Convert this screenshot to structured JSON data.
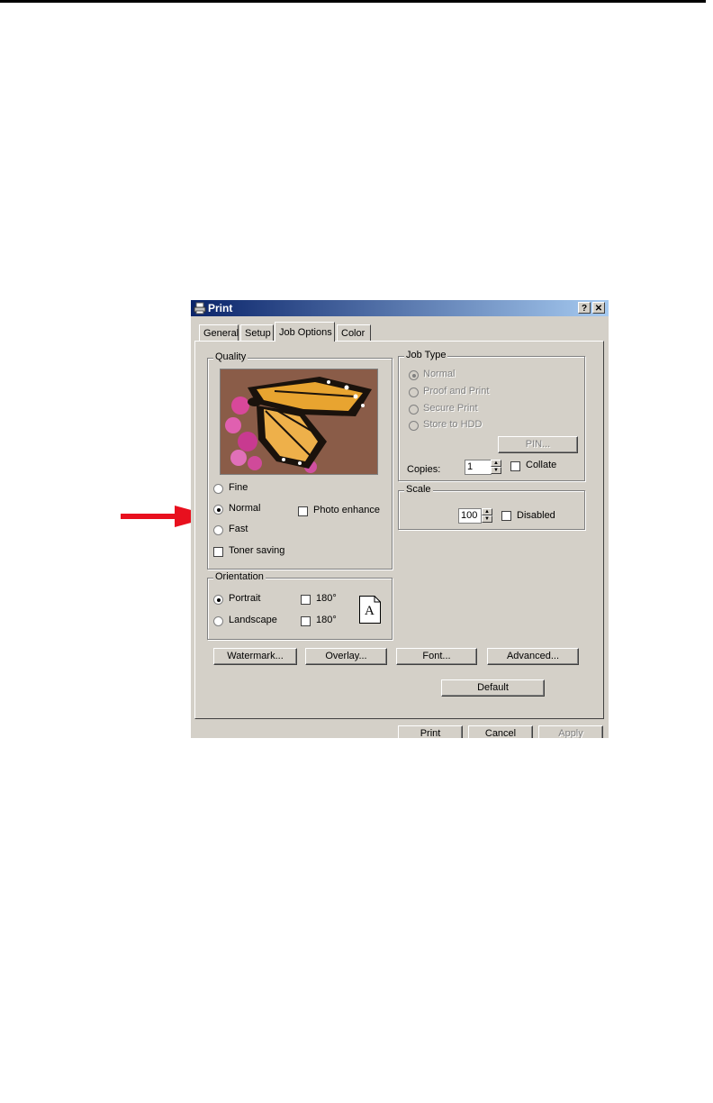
{
  "dialog": {
    "title": "Print",
    "help_label": "?",
    "close_label": "✕"
  },
  "tabs": [
    {
      "label": "General"
    },
    {
      "label": "Setup"
    },
    {
      "label": "Job Options",
      "active": true
    },
    {
      "label": "Color"
    }
  ],
  "quality": {
    "legend": "Quality",
    "options": [
      {
        "label": "Fine",
        "selected": false
      },
      {
        "label": "Normal",
        "selected": true
      },
      {
        "label": "Fast",
        "selected": false
      }
    ],
    "photo_enhance": {
      "label": "Photo enhance",
      "checked": false
    },
    "toner_saving": {
      "label": "Toner saving",
      "checked": false
    }
  },
  "job_type": {
    "legend": "Job Type",
    "options": [
      {
        "label": "Normal",
        "selected": true
      },
      {
        "label": "Proof and Print",
        "selected": false
      },
      {
        "label": "Secure Print",
        "selected": false
      },
      {
        "label": "Store to HDD",
        "selected": false
      }
    ],
    "pin_button": "PIN...",
    "copies_label": "Copies:",
    "copies_value": "1",
    "collate": {
      "label": "Collate",
      "checked": false
    }
  },
  "scale": {
    "legend": "Scale",
    "value": "100",
    "disabled": {
      "label": "Disabled",
      "checked": false
    }
  },
  "orientation": {
    "legend": "Orientation",
    "portrait": {
      "label": "Portrait",
      "selected": true
    },
    "landscape": {
      "label": "Landscape",
      "selected": false
    },
    "rotate_portrait": {
      "label": "180°",
      "checked": false
    },
    "rotate_landscape": {
      "label": "180°",
      "checked": false
    },
    "page_icon_letter": "A"
  },
  "buttons": {
    "watermark": "Watermark...",
    "overlay": "Overlay...",
    "font": "Font...",
    "advanced": "Advanced...",
    "default": "Default",
    "print": "Print",
    "cancel": "Cancel",
    "apply": "Apply"
  },
  "colors": {
    "titlebar_start": "#0a246a",
    "dialog_face": "#d4d0c8",
    "callout_arrow": "#e8101e"
  }
}
